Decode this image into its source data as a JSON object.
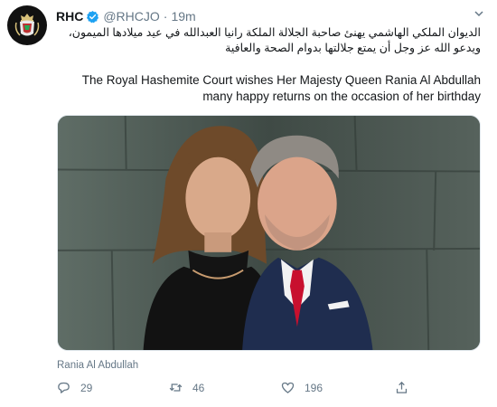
{
  "tweet": {
    "author_name": "RHC",
    "author_handle": "@RHCJO",
    "separator": "·",
    "time": "19m",
    "verified_color": "#1da1f2",
    "text_arabic": "الديوان الملكي الهاشمي يهنئ صاحبة الجلالة الملكة رانيا العبدالله في عيد ميلادها الميمون، ويدعو الله عز وجل أن يمتع جلالتها بدوام الصحة والعافية",
    "text_english_line1": "The Royal Hashemite Court wishes Her Majesty Queen Rania Al Abdullah",
    "text_english_line2": "many happy returns on the occasion of her birthday",
    "media_tag": "Rania Al Abdullah",
    "replies": "29",
    "retweets": "46",
    "likes": "196"
  },
  "icons": {
    "avatar": "royal-crest-icon",
    "verified": "verified-badge-icon",
    "menu": "chevron-down-icon",
    "reply": "reply-icon",
    "retweet": "retweet-icon",
    "like": "heart-icon",
    "share": "share-icon"
  },
  "colors": {
    "text": "#14171a",
    "secondary": "#657786"
  }
}
